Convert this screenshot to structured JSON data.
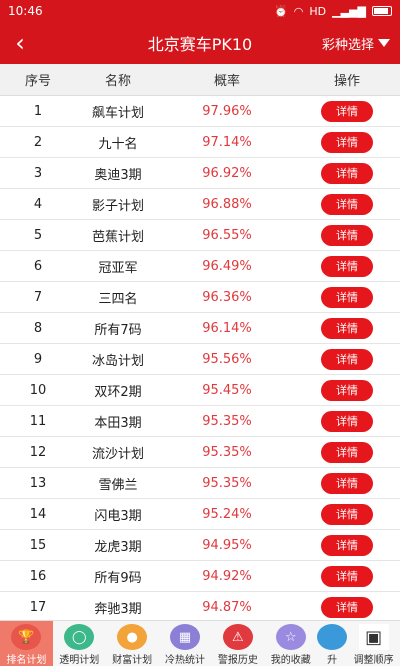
{
  "status": {
    "time": "10:46",
    "net": "HD"
  },
  "appbar": {
    "back": "‹",
    "title": "北京赛车PK10",
    "lottery_select": "彩种选择"
  },
  "table": {
    "headers": {
      "idx": "序号",
      "name": "名称",
      "rate": "概率",
      "op": "操作"
    },
    "rows": [
      {
        "idx": "1",
        "name": "飙车计划",
        "rate": "97.96%",
        "op": "详情"
      },
      {
        "idx": "2",
        "name": "九十名",
        "rate": "97.14%",
        "op": "详情"
      },
      {
        "idx": "3",
        "name": "奥迪3期",
        "rate": "96.92%",
        "op": "详情"
      },
      {
        "idx": "4",
        "name": "影子计划",
        "rate": "96.88%",
        "op": "详情"
      },
      {
        "idx": "5",
        "name": "芭蕉计划",
        "rate": "96.55%",
        "op": "详情"
      },
      {
        "idx": "6",
        "name": "冠亚军",
        "rate": "96.49%",
        "op": "详情"
      },
      {
        "idx": "7",
        "name": "三四名",
        "rate": "96.36%",
        "op": "详情"
      },
      {
        "idx": "8",
        "name": "所有7码",
        "rate": "96.14%",
        "op": "详情"
      },
      {
        "idx": "9",
        "name": "冰岛计划",
        "rate": "95.56%",
        "op": "详情"
      },
      {
        "idx": "10",
        "name": "双环2期",
        "rate": "95.45%",
        "op": "详情"
      },
      {
        "idx": "11",
        "name": "本田3期",
        "rate": "95.35%",
        "op": "详情"
      },
      {
        "idx": "12",
        "name": "流沙计划",
        "rate": "95.35%",
        "op": "详情"
      },
      {
        "idx": "13",
        "name": "雪佛兰",
        "rate": "95.35%",
        "op": "详情"
      },
      {
        "idx": "14",
        "name": "闪电3期",
        "rate": "95.24%",
        "op": "详情"
      },
      {
        "idx": "15",
        "name": "龙虎3期",
        "rate": "94.95%",
        "op": "详情"
      },
      {
        "idx": "16",
        "name": "所有9码",
        "rate": "94.92%",
        "op": "详情"
      },
      {
        "idx": "17",
        "name": "奔驰3期",
        "rate": "94.87%",
        "op": "详情"
      }
    ]
  },
  "tabs": [
    {
      "label": "排名计划",
      "icon": "trophy-icon",
      "color": "#e8554a",
      "glyph": "🏆"
    },
    {
      "label": "透明计划",
      "icon": "ring-icon",
      "color": "#3cb88a",
      "glyph": "◯"
    },
    {
      "label": "财富计划",
      "icon": "coins-icon",
      "color": "#f2a33a",
      "glyph": "●"
    },
    {
      "label": "冷热统计",
      "icon": "chart-icon",
      "color": "#8b7fd6",
      "glyph": "▦"
    },
    {
      "label": "警报历史",
      "icon": "alarm-icon",
      "color": "#e0393e",
      "glyph": "⚠"
    },
    {
      "label": "我的收藏",
      "icon": "star-icon",
      "color": "#9b8be0",
      "glyph": "☆"
    },
    {
      "label": "升",
      "icon": "partial-icon",
      "color": "#3a9ad9",
      "glyph": ""
    },
    {
      "label": "调整顺序",
      "icon": "grid-icon",
      "color": "#ffffff",
      "glyph": "▣"
    }
  ]
}
